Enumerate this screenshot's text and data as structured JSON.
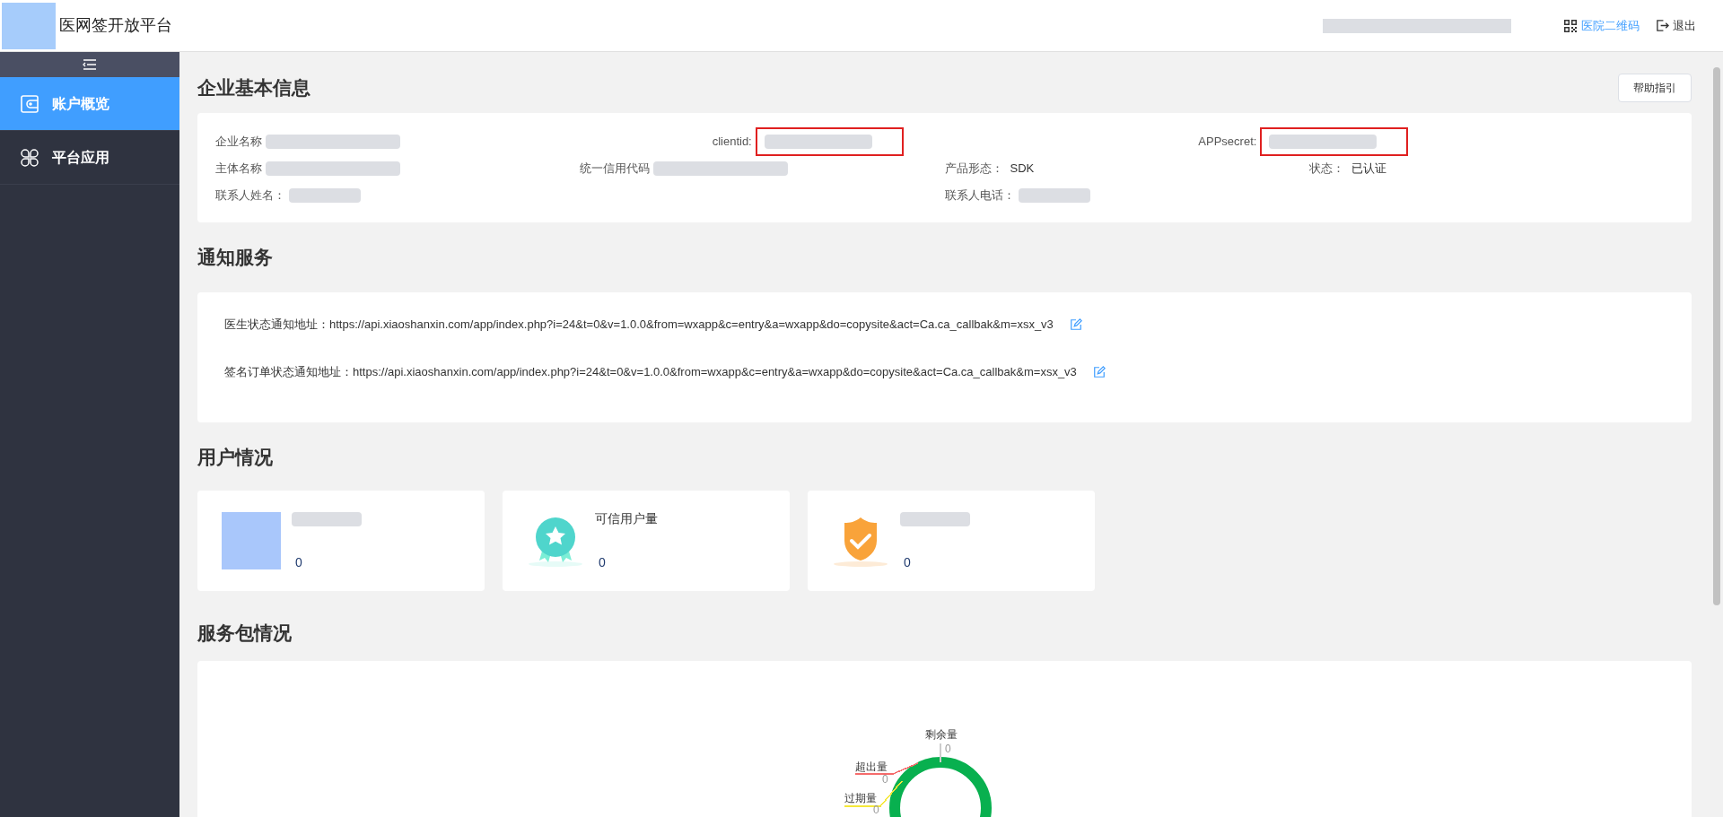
{
  "header": {
    "app_name": "医网签开放平台",
    "links": [
      {
        "kind": "qr",
        "label": "医院二维码"
      },
      {
        "kind": "logout",
        "label": "退出"
      }
    ]
  },
  "sidebar": {
    "items": [
      {
        "kind": "wallet",
        "label": "账户概览",
        "selected": true
      },
      {
        "kind": "apps",
        "label": "平台应用",
        "selected": false
      }
    ]
  },
  "company_info": {
    "title": "企业基本信息",
    "help_button": "帮助指引",
    "rows": [
      [
        {
          "label": "企业名称",
          "highlighted": false
        },
        {
          "label": "clientid:",
          "highlighted": true
        },
        {
          "label": "APPsecret:",
          "highlighted": true
        }
      ],
      [
        {
          "label": "主体名称",
          "highlighted": false
        },
        {
          "label": "统一信用代码",
          "highlighted": false
        },
        {
          "label": "产品形态：",
          "value": "SDK"
        },
        {
          "label": "状态：",
          "value": "已认证"
        }
      ],
      [
        {
          "label": "联系人姓名：",
          "highlighted": false
        },
        {
          "label": "联系人电话：",
          "highlighted": false
        }
      ]
    ]
  },
  "notification": {
    "title": "通知服务",
    "items": [
      {
        "label": "医生状态通知地址：",
        "url": "https://api.xiaoshanxin.com/app/index.php?i=24&t=0&v=1.0.0&from=wxapp&c=entry&a=wxapp&do=copysite&act=Ca.ca_callbak&m=xsx_v3"
      },
      {
        "label": "签名订单状态通知地址：",
        "url": "https://api.xiaoshanxin.com/app/index.php?i=24&t=0&v=1.0.0&from=wxapp&c=entry&a=wxapp&do=copysite&act=Ca.ca_callbak&m=xsx_v3"
      }
    ]
  },
  "users": {
    "title": "用户情况",
    "cards": [
      {
        "kind": "picture",
        "value": "0"
      },
      {
        "kind": "badge",
        "label": "可信用户量",
        "value": "0"
      },
      {
        "kind": "shield",
        "value": "0"
      }
    ]
  },
  "packages": {
    "title": "服务包情况",
    "segments": [
      {
        "label": "剩余量",
        "value": "0",
        "color": "#08b04f"
      },
      {
        "label": "超出量",
        "value": "0",
        "color": "#f56c6c"
      },
      {
        "label": "过期量",
        "value": "0",
        "color": "#f5e83a"
      }
    ]
  }
}
